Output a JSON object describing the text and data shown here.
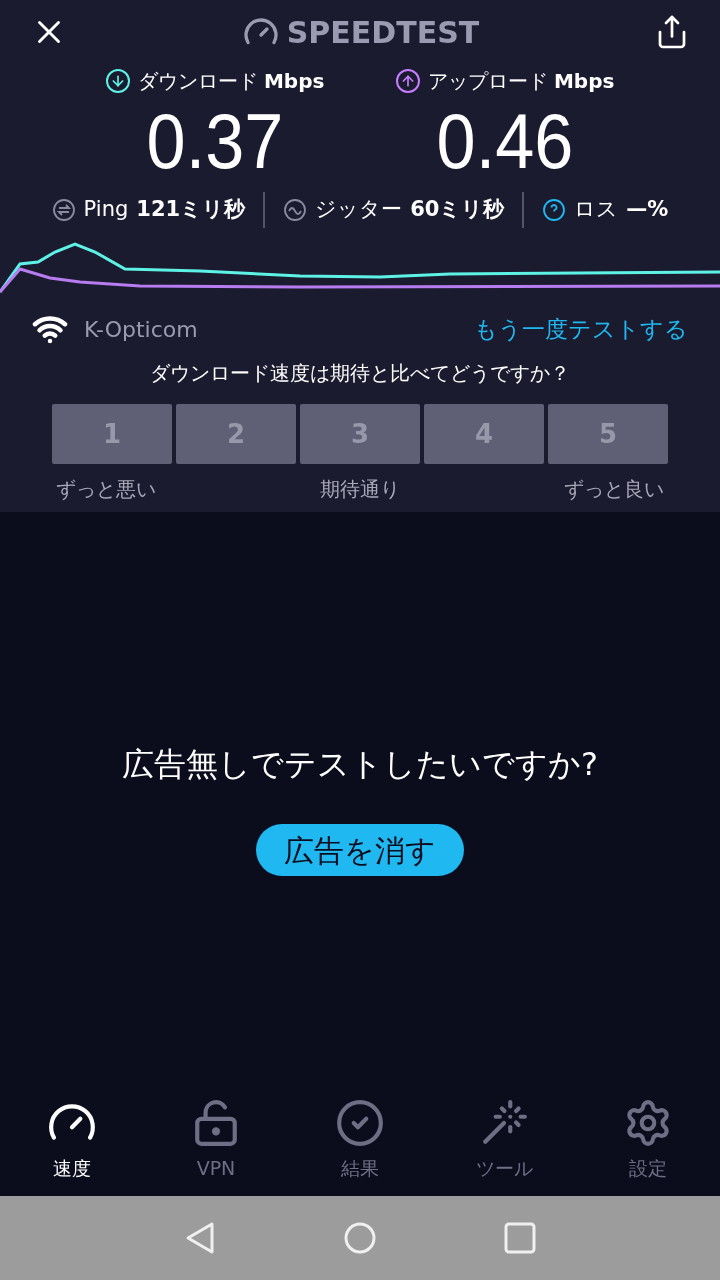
{
  "header": {
    "title": "SPEEDTEST"
  },
  "results": [
    {
      "kind": "download",
      "label": "ダウンロード",
      "unit": "Mbps",
      "value": "0.37",
      "color": "#5ef2e6"
    },
    {
      "kind": "upload",
      "label": "アップロード",
      "unit": "Mbps",
      "value": "0.46",
      "color": "#c77dff"
    }
  ],
  "stats": [
    {
      "kind": "ping",
      "label": "Ping",
      "value": "121ミリ秒"
    },
    {
      "kind": "jitter",
      "label": "ジッター",
      "value": "60ミリ秒"
    },
    {
      "kind": "loss",
      "label": "ロス",
      "value": "—%"
    }
  ],
  "network": {
    "name": "K-Opticom",
    "retest": "もう一度テストする"
  },
  "rating": {
    "question": "ダウンロード速度は期待と比べてどうですか？",
    "options": [
      "1",
      "2",
      "3",
      "4",
      "5"
    ],
    "scale_labels": [
      "ずっと悪い",
      "期待通り",
      "ずっと良い"
    ]
  },
  "ad": {
    "message": "広告無しでテストしたいですか?",
    "button": "広告を消す"
  },
  "nav": [
    {
      "kind": "speed",
      "label": "速度",
      "selected": true
    },
    {
      "kind": "vpn",
      "label": "VPN",
      "selected": false
    },
    {
      "kind": "results",
      "label": "結果",
      "selected": false
    },
    {
      "kind": "tools",
      "label": "ツール",
      "selected": false
    },
    {
      "kind": "settings",
      "label": "設定",
      "selected": false
    }
  ]
}
